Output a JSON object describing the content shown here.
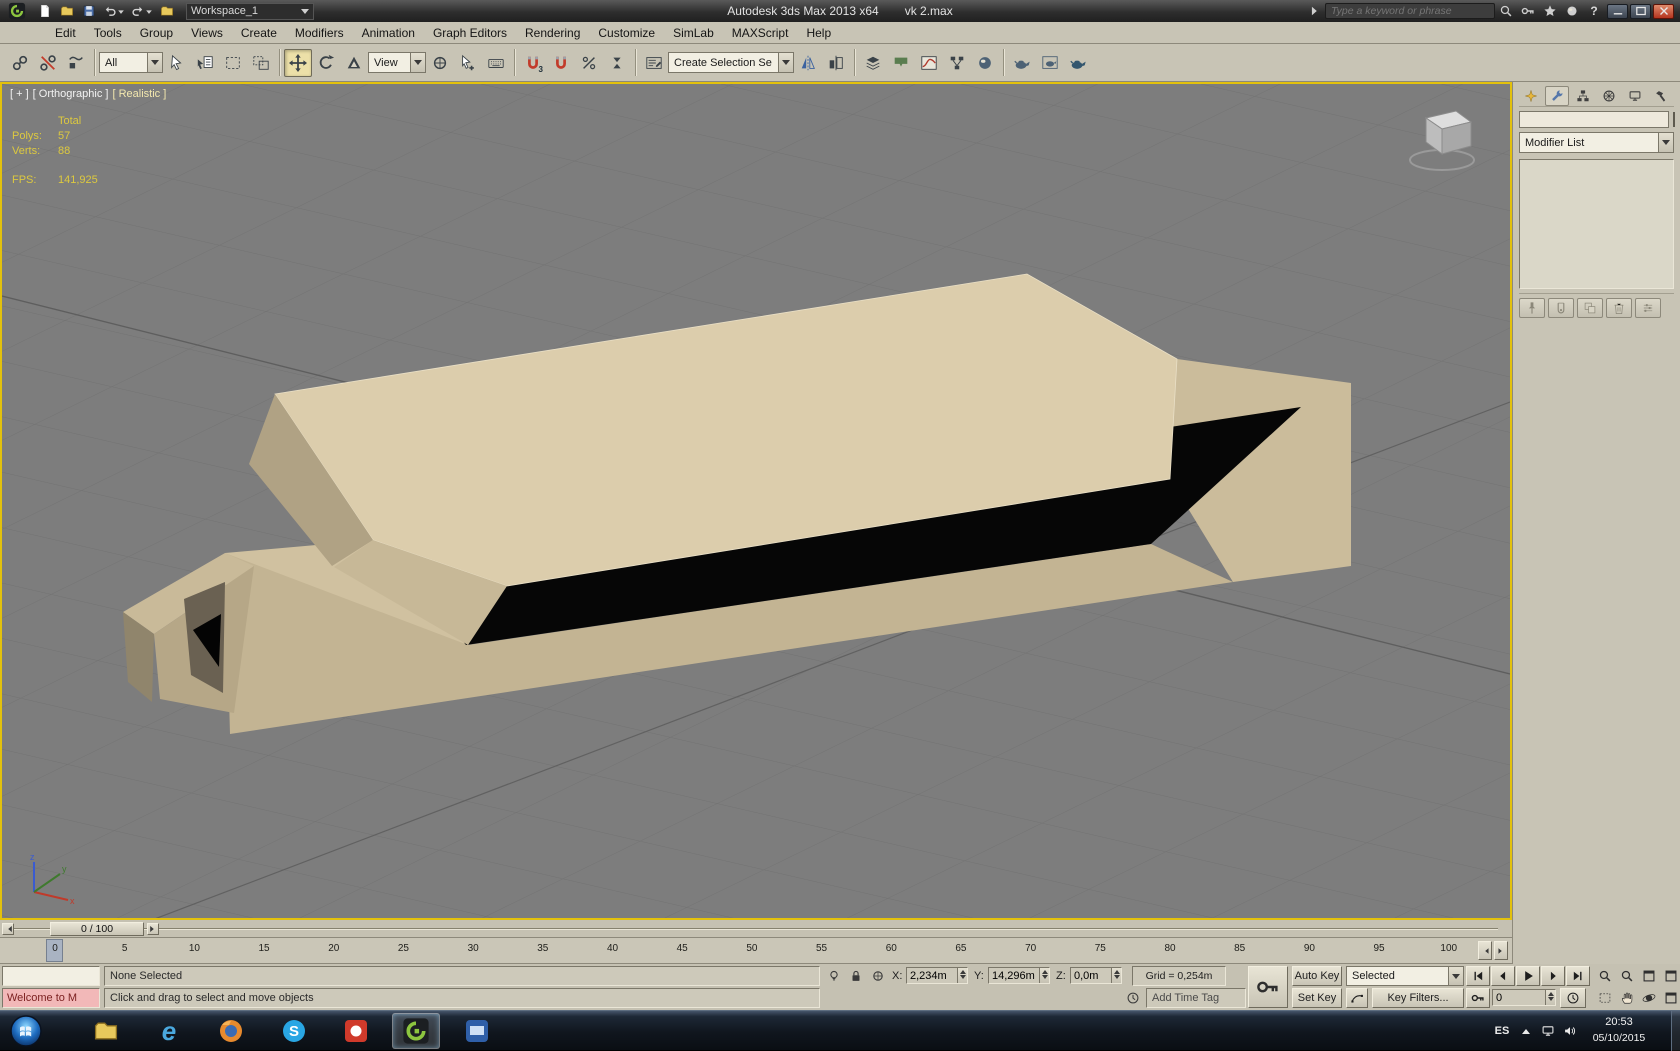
{
  "titlebar": {
    "app_title": "Autodesk 3ds Max 2013 x64",
    "file_name": "vk 2.max",
    "workspace": "Workspace_1",
    "search_placeholder": "Type a keyword or phrase"
  },
  "menubar": {
    "items": [
      "Edit",
      "Tools",
      "Group",
      "Views",
      "Create",
      "Modifiers",
      "Animation",
      "Graph Editors",
      "Rendering",
      "Customize",
      "SimLab",
      "MAXScript",
      "Help"
    ]
  },
  "toolbar": {
    "selection_filter_value": "All",
    "reference_coordinate_value": "View",
    "named_selection_value": "Create Selection Se"
  },
  "viewport": {
    "label_general": "[ + ]",
    "label_pov": "[ Orthographic ]",
    "label_shading": "[ Realistic ]",
    "stats": {
      "total_label": "Total",
      "polys_label": "Polys:",
      "polys_value": "57",
      "verts_label": "Verts:",
      "verts_value": "88",
      "fps_label": "FPS:",
      "fps_value": "141,925"
    }
  },
  "command_panel": {
    "object_name_value": "",
    "modifier_list_label": "Modifier List"
  },
  "timeline": {
    "slider_label": "0 / 100",
    "ticks": [
      "0",
      "5",
      "10",
      "15",
      "20",
      "25",
      "30",
      "35",
      "40",
      "45",
      "50",
      "55",
      "60",
      "65",
      "70",
      "75",
      "80",
      "85",
      "90",
      "95",
      "100"
    ]
  },
  "status": {
    "maxscript_listener_text": "Welcome to M",
    "selection_status": "None Selected",
    "prompt": "Click and drag to select and move objects",
    "x_label": "X:",
    "x_value": "2,234m",
    "y_label": "Y:",
    "y_value": "14,296m",
    "z_label": "Z:",
    "z_value": "0,0m",
    "grid_readout": "Grid = 0,254m",
    "add_time_tag": "Add Time Tag",
    "auto_key_label": "Auto Key",
    "set_key_label": "Set Key",
    "key_mode_value": "Selected",
    "key_filters_label": "Key Filters...",
    "frame_value": "0"
  },
  "taskbar": {
    "language": "ES",
    "clock_time": "20:53",
    "clock_date": "05/10/2015"
  },
  "icons": {
    "snap_3d_badge": "3",
    "help_glyph": "?",
    "ie_glyph": "e",
    "skype_glyph": "S",
    "search-icon": "binoculars/magnifier",
    "select-and-move-icon": "cross-arrows",
    "select-and-rotate-icon": "circular-arrow",
    "snap-toggle-icon": "magnet",
    "render-setup-icon": "teapot",
    "set-key-icon": "key",
    "pan-icon": "hand",
    "orbit-icon": "orbit-ellipse",
    "close-icon": "x",
    "start-orb-icon": "windows-flag"
  },
  "colors": {
    "viewport_background": "#7d7d7d",
    "active_viewport_border": "#e3c10c",
    "stats_text": "#ddc93f",
    "model_tan": "#dccdac",
    "ui_gray": "#c8c4b5"
  }
}
